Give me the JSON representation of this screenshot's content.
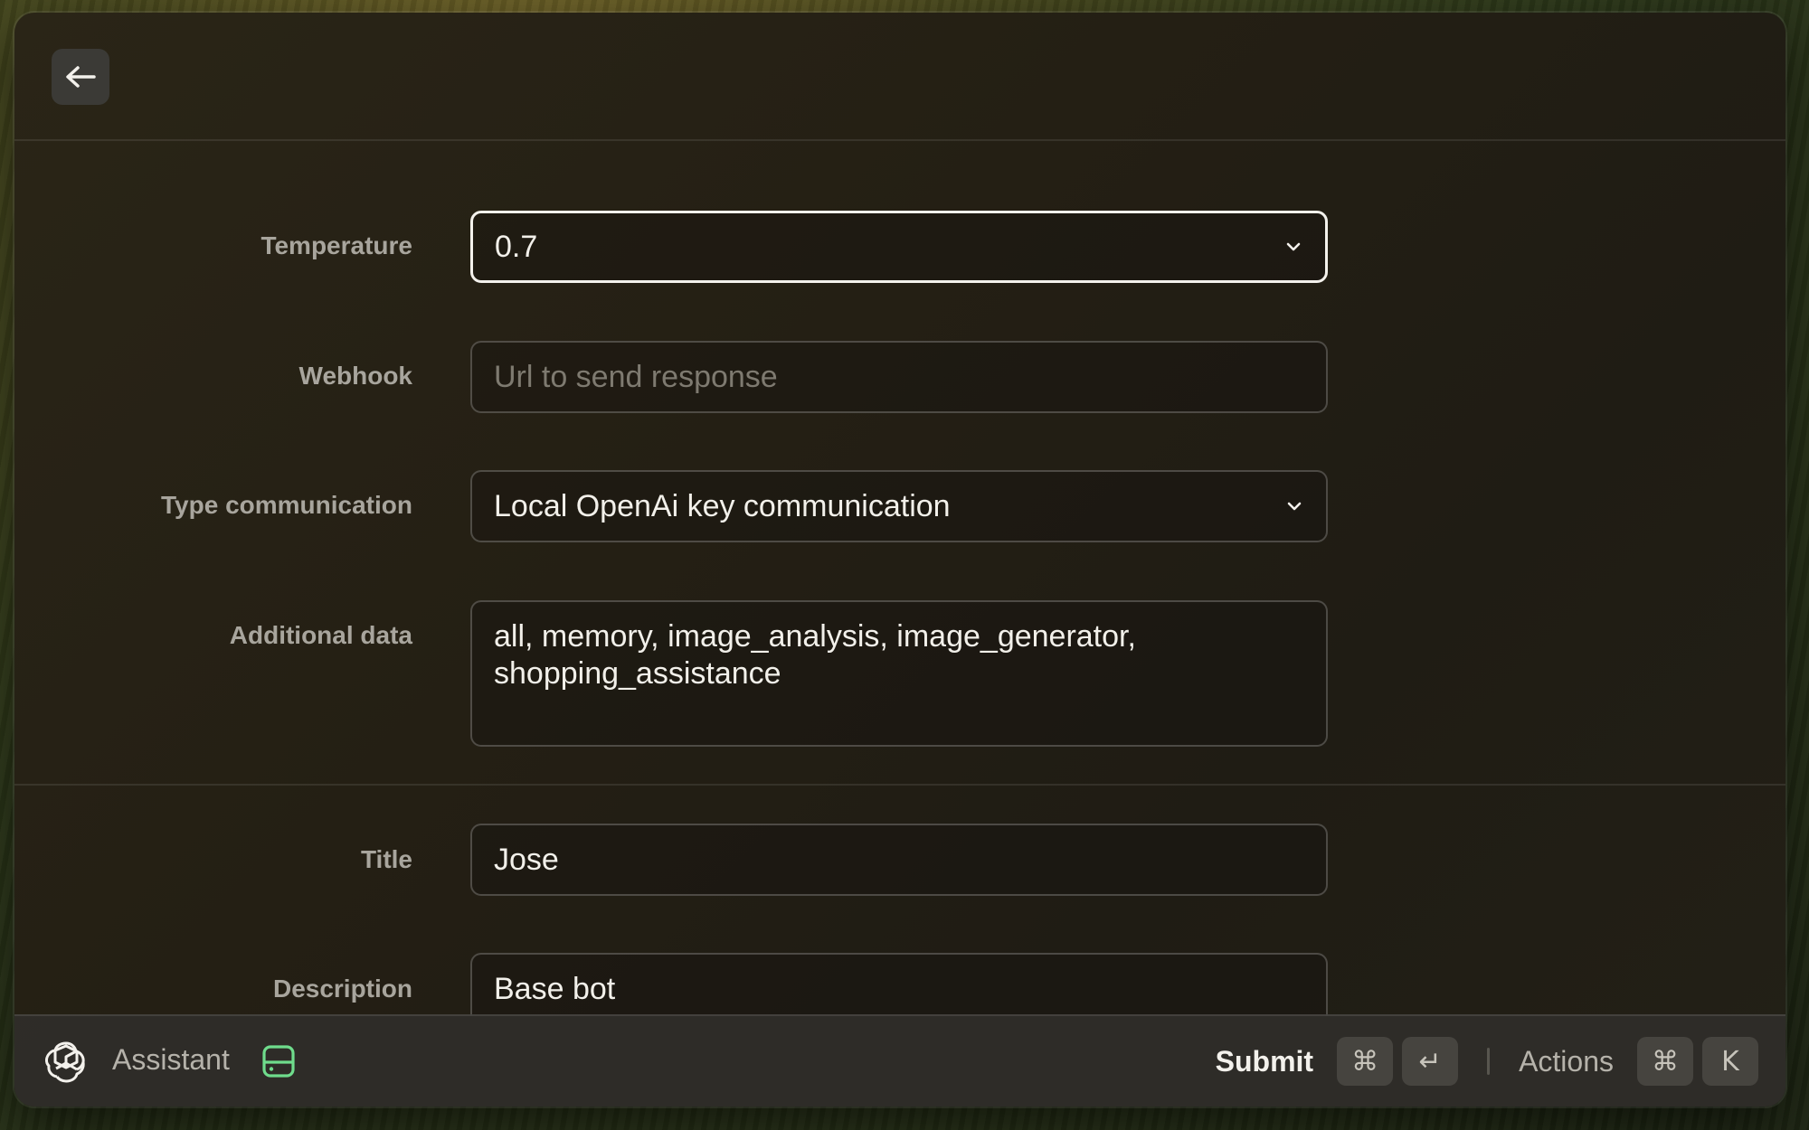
{
  "header": {
    "back_icon": "arrow-left-icon"
  },
  "form": {
    "temperature": {
      "label": "Temperature",
      "value": "0.7"
    },
    "webhook": {
      "label": "Webhook",
      "value": "",
      "placeholder": "Url to send response"
    },
    "type_communication": {
      "label": "Type communication",
      "value": "Local OpenAi key communication"
    },
    "additional_data": {
      "label": "Additional data",
      "value": "all, memory, image_analysis, image_generator, shopping_assistance"
    },
    "title": {
      "label": "Title",
      "value": "Jose"
    },
    "description": {
      "label": "Description",
      "value": "Base bot"
    }
  },
  "footer": {
    "app_icon": "openai-logo-icon",
    "title": "Assistant",
    "storage_icon": "hard-drive-icon",
    "storage_icon_color": "#6fdc8c",
    "submit_label": "Submit",
    "submit_keys": [
      "⌘",
      "↵"
    ],
    "actions_label": "Actions",
    "actions_keys": [
      "⌘",
      "K"
    ]
  },
  "colors": {
    "focus_border": "#f3f1ec",
    "accent_green": "#6fdc8c"
  }
}
